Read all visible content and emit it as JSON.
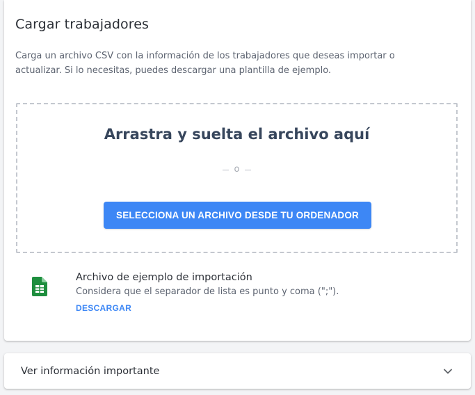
{
  "upload": {
    "title": "Cargar trabajadores",
    "description": "Carga un archivo CSV con la información de los trabajadores que deseas importar o actualizar. Si lo necesitas, puedes descargar una plantilla de ejemplo.",
    "dropzone": {
      "title": "Arrastra y suelta el archivo aquí",
      "separator": "o",
      "button_label": "SELECCIONA UN ARCHIVO DESDE TU ORDENADOR"
    },
    "sample": {
      "icon": "spreadsheet-icon",
      "title": "Archivo de ejemplo de importación",
      "note": "Considera que el separador de lista es punto y coma (\";\").",
      "download_label": "DESCARGAR"
    }
  },
  "info_panel": {
    "label": "Ver información importante",
    "icon": "chevron-down-icon",
    "expanded": false
  },
  "colors": {
    "accent": "#3d87f5",
    "sheet_icon": "#1e8e3e",
    "heading": "#37465c"
  }
}
